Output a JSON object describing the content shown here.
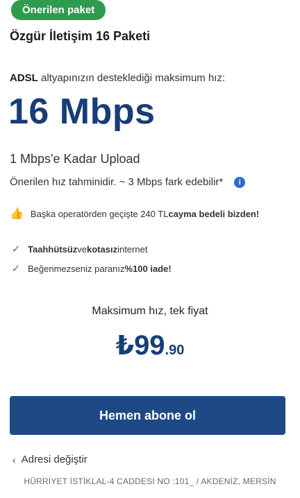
{
  "badge": "Önerilen paket",
  "package_title": "Özgür İletişim 16 Paketi",
  "infra": {
    "bold": "ADSL",
    "rest": " altyapınızın desteklediği maksimum hız:"
  },
  "speed": "16 Mbps",
  "upload": "1 Mbps'e Kadar Upload",
  "note": "Önerilen hız tahminidir. ~ 3 Mbps fark edebilir*",
  "promo": {
    "text": "Başka operatörden geçişte 240 TL ",
    "bold": "cayma bedeli bizden!"
  },
  "features": [
    {
      "bold1": "Taahhütsüz",
      "mid": " ve ",
      "bold2": "kotasız",
      "rest": " internet"
    },
    {
      "text": "Beğenmezseniz paranız ",
      "bold": "%100 iade!"
    }
  ],
  "price": {
    "title": "Maksimum hız, tek fiyat",
    "currency": "₺",
    "main": "99",
    "cents": ".90"
  },
  "cta_label": "Hemen abone ol",
  "change_address": "Adresi değiştir",
  "address": "HÜRRİYET İSTİKLAL-4 CADDESİ NO :101_ / AKDENİZ, MERSİN",
  "colors": {
    "accent_green": "#2e9b4f",
    "brand_blue": "#183d78",
    "button_blue": "#1e4886",
    "info_blue": "#2b6bd6"
  }
}
